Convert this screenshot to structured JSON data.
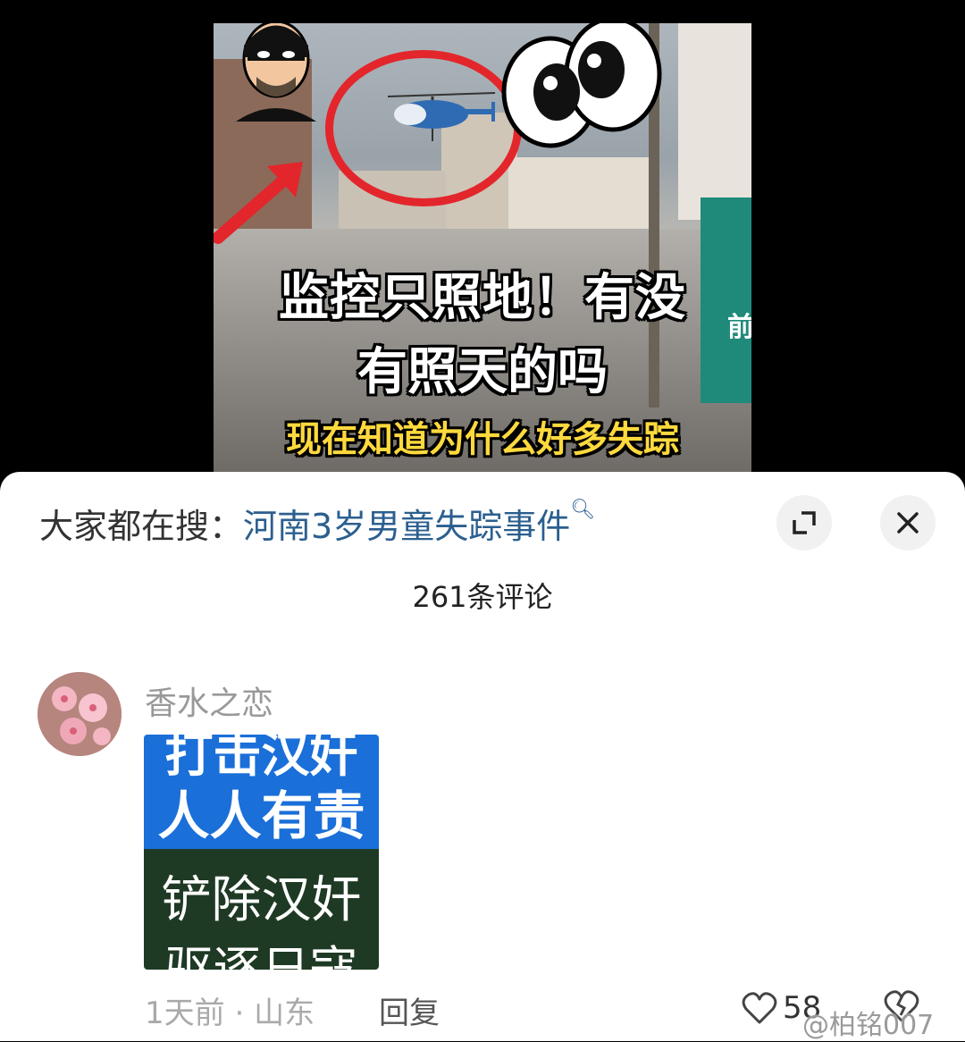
{
  "video": {
    "headline_line1": "监控只照地！有没",
    "headline_line2": "有照天的吗",
    "subtitle": "现在知道为什么好多失踪",
    "wall_sign": "前"
  },
  "search": {
    "prefix": "大家都在搜：",
    "query": "河南3岁男童失踪事件"
  },
  "comments_header": "261条评论",
  "comment": {
    "username": "香水之恋",
    "sticker_lines": [
      "打击汉奸",
      "人人有责",
      "铲除汉奸",
      "驱逐日寇"
    ],
    "time": "1天前",
    "location": "山东",
    "meta_sep": " · ",
    "reply_label": "回复",
    "like_count": "58"
  },
  "watermark": "@柏铭007",
  "icons": {
    "expand": "expand-icon",
    "close": "close-icon",
    "like": "heart-icon",
    "dislike": "broken-heart-icon",
    "search": "search-icon"
  },
  "colors": {
    "link": "#2b5f8f",
    "circle_red": "#e3262b",
    "subtitle_yellow": "#ffd93d",
    "sticker_blue": "#1a6fd9",
    "sticker_green": "#1f3a24"
  }
}
